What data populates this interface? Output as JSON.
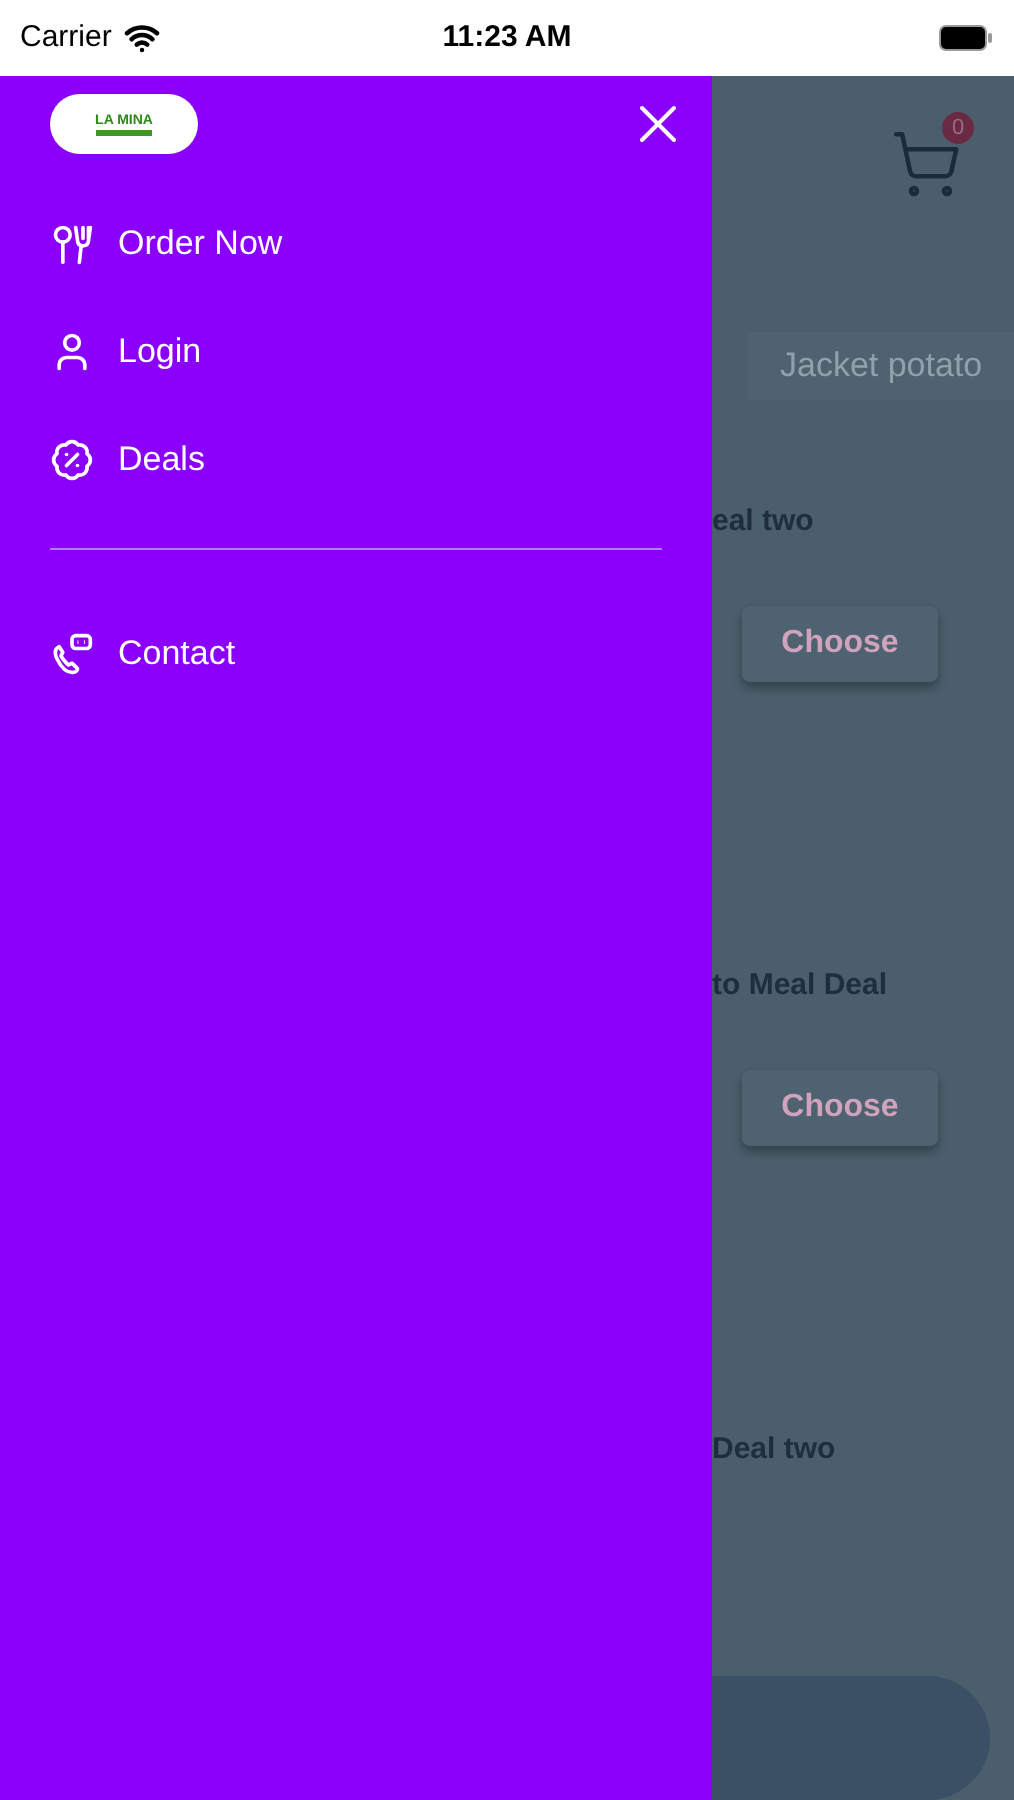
{
  "status_bar": {
    "carrier": "Carrier",
    "time": "11:23 AM"
  },
  "drawer": {
    "logo": "LA MINA",
    "items": [
      {
        "kind": "order",
        "label": "Order Now"
      },
      {
        "kind": "user",
        "label": "Login"
      },
      {
        "kind": "deals",
        "label": "Deals"
      },
      {
        "kind": "divider"
      },
      {
        "kind": "contact",
        "label": "Contact"
      }
    ]
  },
  "background": {
    "cart_count": "0",
    "search_value": "Jacket potato",
    "deals": [
      {
        "title": "eal two",
        "button": "Choose"
      },
      {
        "title": "to Meal Deal",
        "button": "Choose"
      },
      {
        "title": "Deal two"
      }
    ]
  }
}
